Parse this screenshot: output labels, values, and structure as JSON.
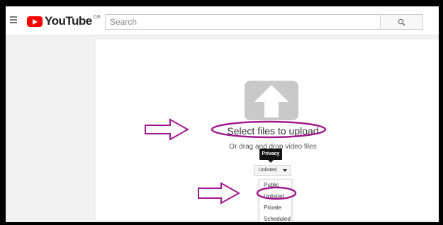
{
  "header": {
    "logo_text": "YouTube",
    "region": "GB",
    "search_placeholder": "Search"
  },
  "upload": {
    "title": "Select files to upload",
    "subtitle": "Or drag and drop video files",
    "tooltip": "Privacy",
    "privacy_selected": "Unlisted",
    "options": [
      "Public",
      "Unlisted",
      "Private",
      "Scheduled"
    ]
  },
  "colors": {
    "annotation": "#a21a8e",
    "brand_red": "#ff0000"
  },
  "icons": {
    "menu": "hamburger-icon",
    "search": "search-icon",
    "upload": "upload-arrow-icon"
  }
}
